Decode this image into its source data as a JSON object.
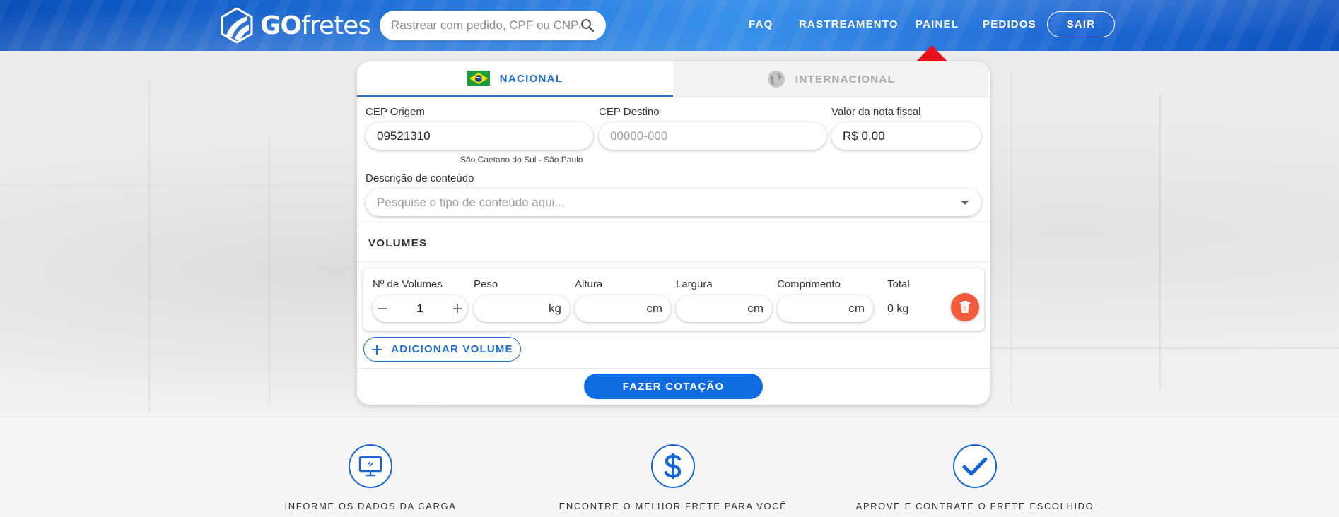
{
  "header": {
    "logo": {
      "prefix": "GO",
      "suffix": "fretes"
    },
    "search": {
      "placeholder": "Rastrear com pedido, CPF ou CNPJ"
    },
    "nav": [
      {
        "label": "FAQ"
      },
      {
        "label": "RASTREAMENTO"
      },
      {
        "label": "PAINEL"
      },
      {
        "label": "PEDIDOS"
      }
    ],
    "logout_label": "SAIR"
  },
  "colors": {
    "accent": "#1e6fd9",
    "primary_button": "#0f6ce0",
    "delete": "#f35b3c",
    "arrow": "#e8101a"
  },
  "tabs": [
    {
      "label": "NACIONAL",
      "icon": "brazil-flag-icon",
      "active": true
    },
    {
      "label": "INTERNACIONAL",
      "icon": "globe-icon",
      "active": false
    }
  ],
  "form": {
    "origin": {
      "label": "CEP Origem",
      "value": "09521310",
      "hint": "São Caetano do Sul - São Paulo"
    },
    "destination": {
      "label": "CEP Destino",
      "value": "",
      "placeholder": "00000-000"
    },
    "invoice": {
      "label": "Valor da nota fiscal",
      "value": "R$ 0,00"
    },
    "content": {
      "label": "Descrição de conteúdo",
      "placeholder": "Pesquise o tipo de conteúdo aqui..."
    }
  },
  "volumes": {
    "title": "VOLUMES",
    "columns": {
      "count": "Nº de Volumes",
      "weight": "Peso",
      "height": "Altura",
      "width": "Largura",
      "length": "Comprimento",
      "total": "Total"
    },
    "row": {
      "count": "1",
      "weight": "",
      "weight_unit": "kg",
      "height": "",
      "height_unit": "cm",
      "width": "",
      "width_unit": "cm",
      "length": "",
      "length_unit": "cm",
      "total": "0 kg"
    },
    "add_label": "ADICIONAR VOLUME"
  },
  "quote_label": "FAZER COTAÇÃO",
  "steps": [
    {
      "icon": "monitor-icon",
      "label": "INFORME OS DADOS DA CARGA"
    },
    {
      "icon": "dollar-icon",
      "label": "ENCONTRE O MELHOR FRETE PARA VOCÊ"
    },
    {
      "icon": "check-icon",
      "label": "APROVE E CONTRATE O FRETE ESCOLHIDO"
    }
  ]
}
